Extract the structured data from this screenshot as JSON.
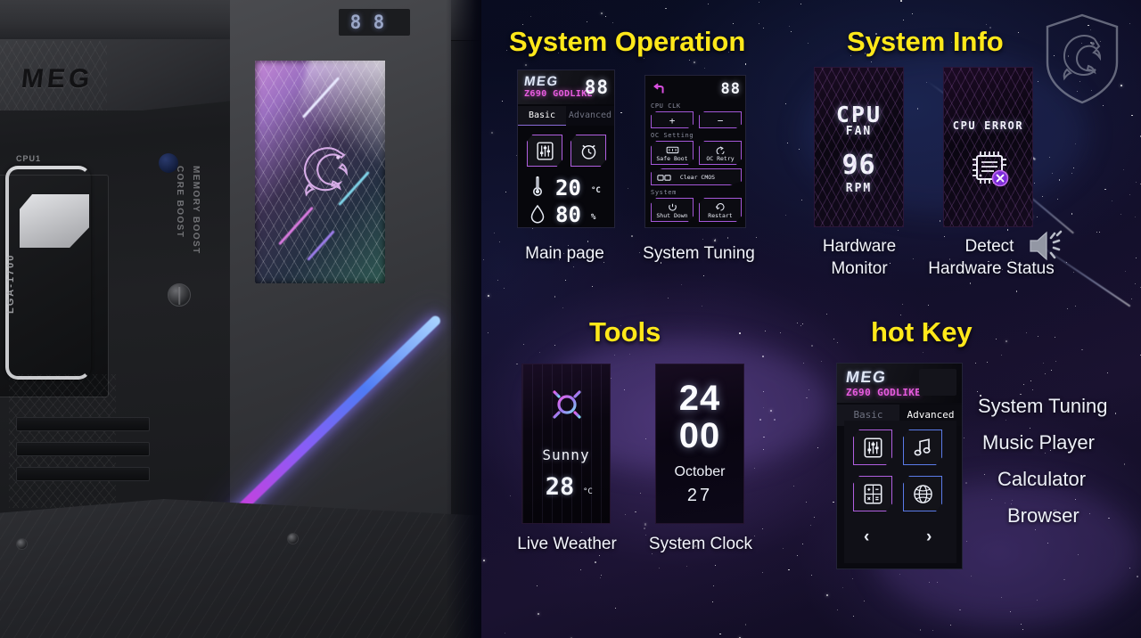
{
  "sections": {
    "system_operation": {
      "title": "System Operation"
    },
    "system_info": {
      "title": "System Info"
    },
    "tools": {
      "title": "Tools"
    },
    "hot_key": {
      "title": "hot Key"
    }
  },
  "captions": {
    "main_page": "Main page",
    "system_tuning": "System Tuning",
    "hardware_monitor_line1": "Hardware",
    "hardware_monitor_line2": "Monitor",
    "detect_line1": "Detect",
    "detect_line2": "Hardware Status",
    "live_weather": "Live Weather",
    "system_clock": "System Clock"
  },
  "main_page_device": {
    "brand": "MEG",
    "model": "Z690 GODLIKE",
    "debug_code": "88",
    "tabs": [
      {
        "label": "Basic",
        "active": true
      },
      {
        "label": "Advanced",
        "active": false
      }
    ],
    "buttons": [
      {
        "icon": "sliders-icon",
        "name": "system-tuning-button"
      },
      {
        "icon": "alarm-clock-icon",
        "name": "alarm-button"
      }
    ],
    "metrics": [
      {
        "icon": "thermometer-icon",
        "value": "20",
        "unit": "°C"
      },
      {
        "icon": "humidity-drop-icon",
        "value": "80",
        "unit": "%"
      }
    ]
  },
  "tuning_device": {
    "debug_code": "88",
    "back_icon": "back-arrow-icon",
    "groups": [
      {
        "label": "CPU CLK",
        "buttons": [
          {
            "text": "+",
            "name": "cpu-clk-increase-button"
          },
          {
            "text": "−",
            "name": "cpu-clk-decrease-button"
          }
        ]
      },
      {
        "label": "OC Setting",
        "buttons": [
          {
            "text": "Safe Boot",
            "name": "safe-boot-button"
          },
          {
            "text": "OC Retry",
            "name": "oc-retry-button"
          },
          {
            "text": "Clear CMOS",
            "name": "clear-cmos-button"
          }
        ]
      },
      {
        "label": "System",
        "buttons": [
          {
            "text": "Shut Down",
            "name": "shut-down-button"
          },
          {
            "text": "Restart",
            "name": "restart-button"
          }
        ]
      }
    ]
  },
  "hardware_monitor_device": {
    "line1": "CPU",
    "line2": "FAN",
    "value": "96",
    "unit": "RPM"
  },
  "hardware_status_device": {
    "title": "CPU ERROR",
    "icon": "cpu-chip-error-icon"
  },
  "weather_device": {
    "icon": "sun-icon",
    "condition": "Sunny",
    "temperature": "28",
    "unit": "°C"
  },
  "clock_device": {
    "hour": "24",
    "minute": "00",
    "month": "October",
    "day": "27"
  },
  "hotkey_device": {
    "brand": "MEG",
    "model": "Z690 GODLIKE",
    "tabs": [
      {
        "label": "Basic",
        "active": false
      },
      {
        "label": "Advanced",
        "active": true
      }
    ],
    "icons": [
      {
        "name": "sliders-icon"
      },
      {
        "name": "music-note-icon"
      },
      {
        "name": "calculator-icon"
      },
      {
        "name": "globe-icon"
      }
    ],
    "nav": {
      "prev": "‹",
      "next": "›"
    }
  },
  "hotkey_list": [
    "System Tuning",
    "Music Player",
    "Calculator",
    "Browser"
  ],
  "board_photo": {
    "brand_logo": "MEG",
    "silkscreen_core": "CORE BOOST",
    "silkscreen_memory": "MEMORY BOOST",
    "cpu_label": "CPU1",
    "socket_label": "LGA-1700",
    "debug_digits": "88"
  },
  "logos": {
    "msi_shield": "msi-dragon-shield-logo",
    "speaker": "speaker-icon"
  },
  "colors": {
    "accent_yellow": "#ffe81a",
    "accent_magenta": "#e85ce0",
    "accent_purple": "#b05fe0",
    "text_white": "#f2f4fb"
  }
}
